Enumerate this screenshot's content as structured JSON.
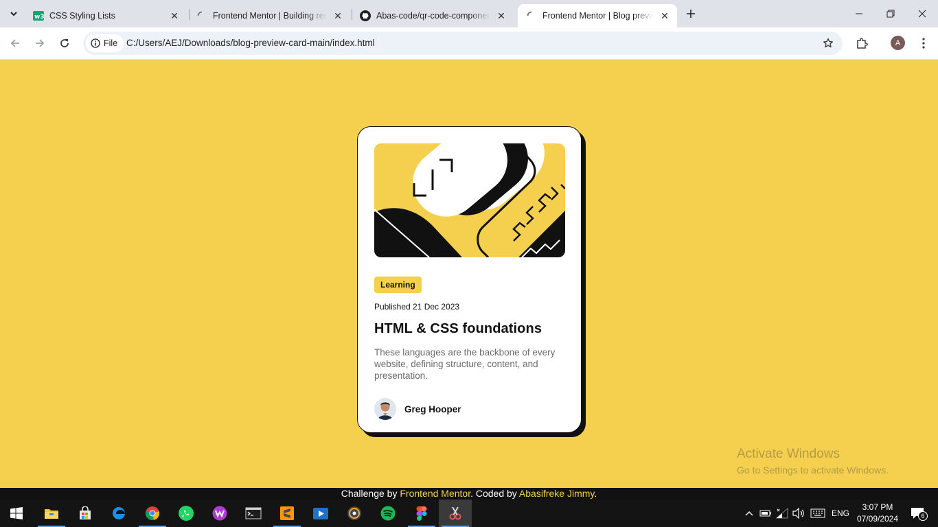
{
  "browser": {
    "tabs": [
      {
        "title": "CSS Styling Lists",
        "favicon": "w3schools-icon",
        "active": false
      },
      {
        "title": "Frontend Mentor | Building resp",
        "favicon": "loading-icon",
        "active": false
      },
      {
        "title": "Abas-code/qr-code-componen",
        "favicon": "github-icon",
        "active": false
      },
      {
        "title": "Frontend Mentor | Blog preview",
        "favicon": "loading-icon",
        "active": true
      }
    ],
    "chip_label": "File",
    "url": "C:/Users/AEJ/Downloads/blog-preview-card-main/index.html",
    "profile_initial": "A"
  },
  "card": {
    "tag": "Learning",
    "published": "Published 21 Dec 2023",
    "heading": "HTML & CSS foundations",
    "description": "These languages are the backbone of every website, defining structure, content, and presentation.",
    "author": "Greg Hooper"
  },
  "attribution": {
    "prefix": "Challenge by ",
    "link1": "Frontend Mentor",
    "middle": ". Coded by ",
    "link2": "Abasifreke Jimmy",
    "suffix": "."
  },
  "watermark": {
    "line1": "Activate Windows",
    "line2": "Go to Settings to activate Windows."
  },
  "taskbar": {
    "apps": [
      "start-icon",
      "file-explorer-icon",
      "store-icon",
      "edge-icon",
      "chrome-icon",
      "whatsapp-icon",
      "wps-office-icon",
      "terminal-icon",
      "sublime-text-icon",
      "media-player-icon",
      "music-app-icon",
      "spotify-icon",
      "figma-icon",
      "snipping-tool-icon"
    ],
    "language": "ENG",
    "time": "3:07 PM",
    "date": "07/09/2024",
    "notification_count": "6"
  },
  "colors": {
    "background": "#f4d04e",
    "text": "#111111",
    "muted_text": "#6b6b6b"
  }
}
